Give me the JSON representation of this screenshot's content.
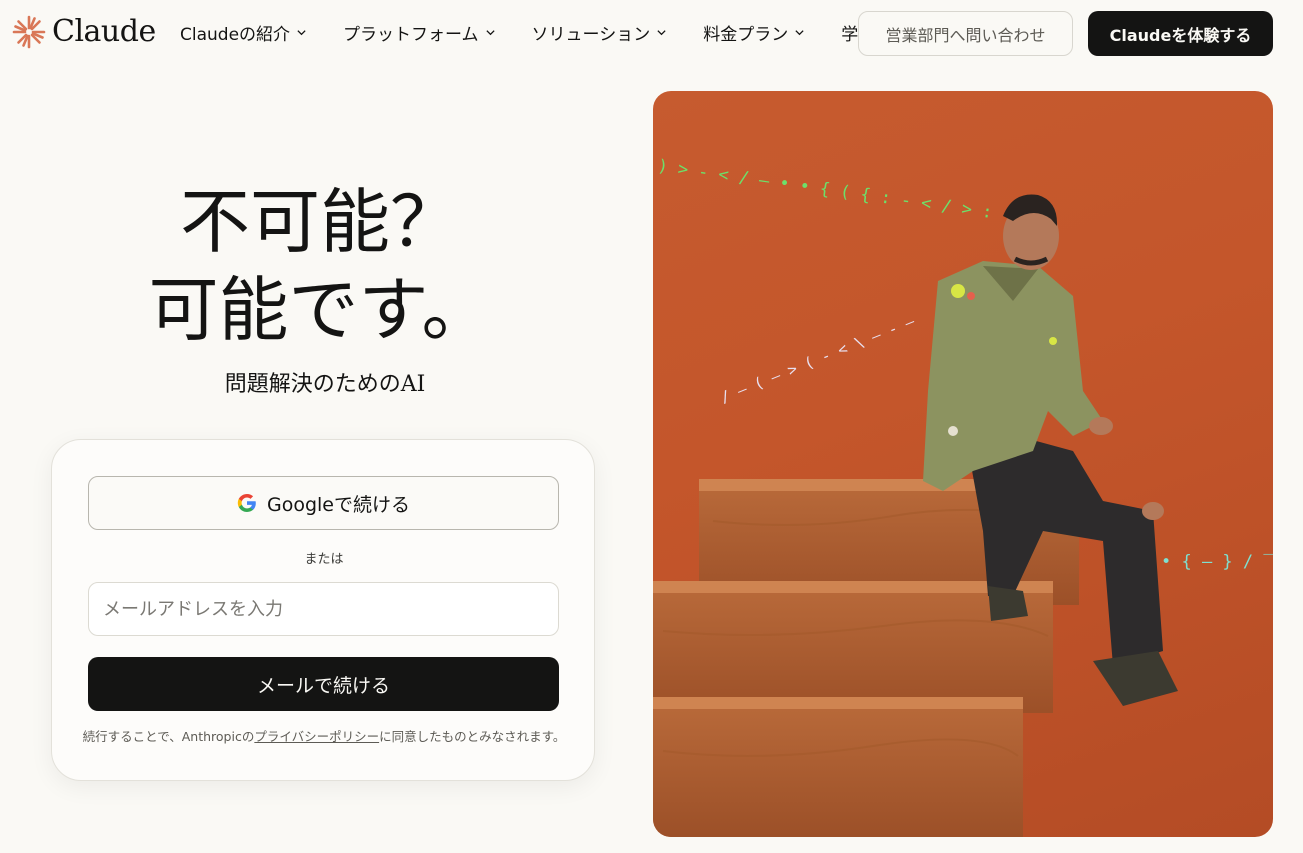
{
  "brand": {
    "name": "Claude",
    "accent": "#d97757"
  },
  "nav": {
    "items": [
      {
        "label": "Claudeの紹介"
      },
      {
        "label": "プラットフォーム"
      },
      {
        "label": "ソリューション"
      },
      {
        "label": "料金プラン"
      },
      {
        "label": "学習"
      }
    ],
    "contact_sales": "営業部門へ問い合わせ",
    "try_claude": "Claudeを体験する"
  },
  "hero": {
    "title_line1": "不可能？",
    "title_line2": "可能です。",
    "subtitle": "問題解決のためのAI"
  },
  "login": {
    "google_label": "Googleで続ける",
    "or_label": "または",
    "email_placeholder": "メールアドレスを入力",
    "email_value": "",
    "email_button": "メールで続ける",
    "terms_prefix": "続行することで、Anthropicの",
    "terms_link": "プライバシーポリシー",
    "terms_suffix": "に同意したものとみなされます。"
  },
  "code_glyphs": {
    "top": ") > - < / — • • { ( { : - < / > : - •",
    "mid": "/ — ( — > ( - < \\ — - —",
    "right": "• { — } / ‾ •"
  },
  "colors": {
    "background": "#faf9f5",
    "dark_button": "#141413",
    "photo_bg": "#c4562b"
  }
}
